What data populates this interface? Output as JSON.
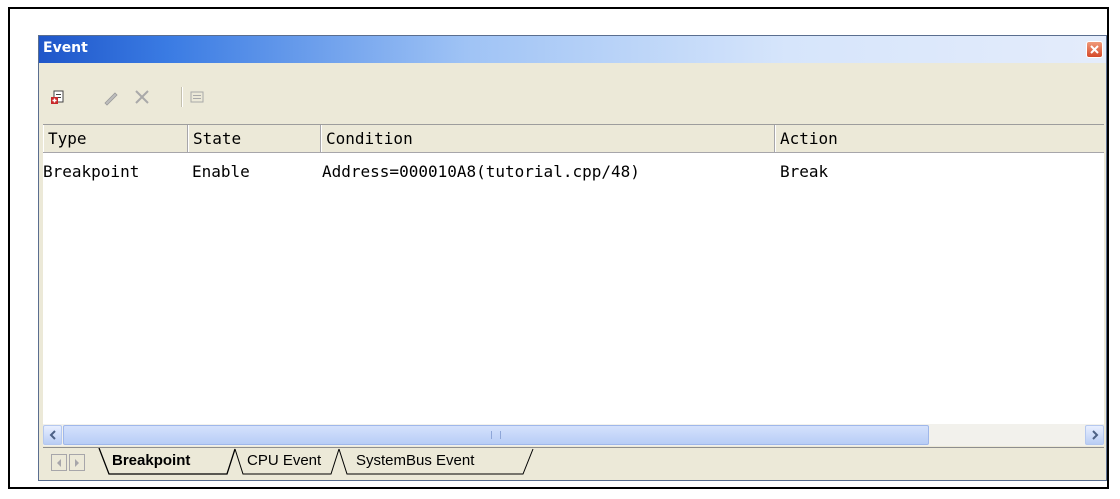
{
  "window": {
    "title": "Event"
  },
  "toolbar": {
    "buttons": [
      {
        "name": "add-event",
        "icon": "new-document-icon"
      },
      {
        "name": "edit-event",
        "icon": "pencil-icon"
      },
      {
        "name": "delete-event",
        "icon": "delete-x-icon"
      },
      {
        "name": "view-properties",
        "icon": "list-view-icon"
      }
    ]
  },
  "table": {
    "columns": [
      "Type",
      "State",
      "Condition",
      "Action"
    ],
    "rows": [
      {
        "type": "Breakpoint",
        "state": "Enable",
        "condition": "Address=000010A8(tutorial.cpp/48)",
        "action": "Break"
      }
    ]
  },
  "tabs": [
    {
      "label": "Breakpoint",
      "active": true
    },
    {
      "label": "CPU Event",
      "active": false
    },
    {
      "label": "SystemBus Event",
      "active": false
    }
  ],
  "colors": {
    "titlebar_start": "#1f56c9",
    "titlebar_end": "#e4ecfb",
    "chrome": "#ece9d8",
    "close_button": "#d54a2a"
  }
}
